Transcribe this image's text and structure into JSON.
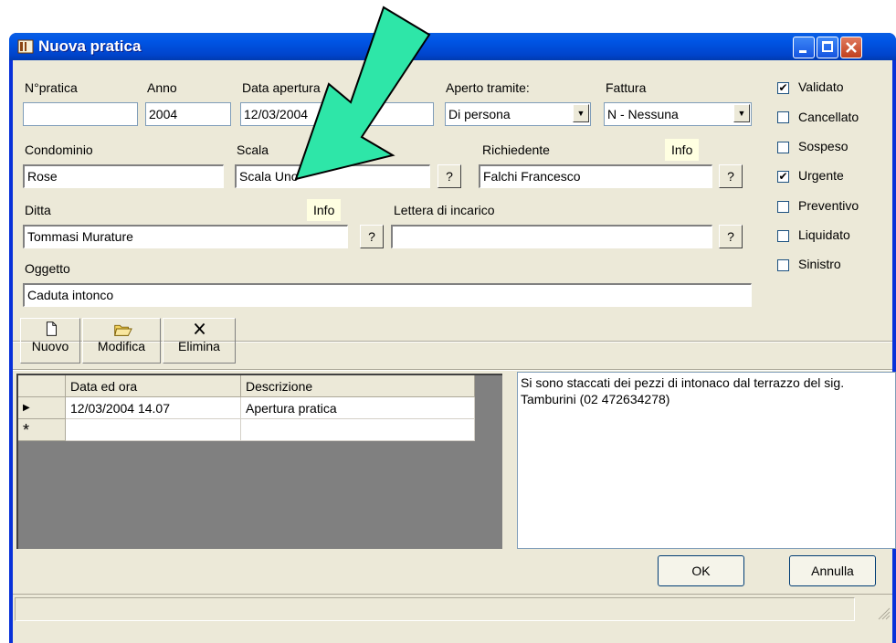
{
  "window": {
    "title": "Nuova pratica"
  },
  "form": {
    "npratica": {
      "label": "N°pratica",
      "value": ""
    },
    "anno": {
      "label": "Anno",
      "value": "2004"
    },
    "data_apertura": {
      "label": "Data apertura",
      "value": "12/03/2004"
    },
    "aperto_tramite": {
      "label": "Aperto tramite:",
      "value": "Di persona"
    },
    "fattura": {
      "label": "Fattura",
      "value": "N - Nessuna"
    },
    "condominio": {
      "label": "Condominio",
      "value": "Rose"
    },
    "scala": {
      "label": "Scala",
      "value": "Scala Uno"
    },
    "richiedente": {
      "label": "Richiedente",
      "value": "Falchi Francesco",
      "info": "Info"
    },
    "ditta": {
      "label": "Ditta",
      "value": "Tommasi Murature",
      "info": "Info"
    },
    "lettera": {
      "label": "Lettera di incarico",
      "value": ""
    },
    "oggetto": {
      "label": "Oggetto",
      "value": "Caduta intonco"
    },
    "lookup_label": "?"
  },
  "checkboxes": [
    {
      "label": "Validato",
      "checked": true
    },
    {
      "label": "Cancellato",
      "checked": false
    },
    {
      "label": "Sospeso",
      "checked": false
    },
    {
      "label": "Urgente",
      "checked": true
    },
    {
      "label": "Preventivo",
      "checked": false
    },
    {
      "label": "Liquidato",
      "checked": false
    },
    {
      "label": "Sinistro",
      "checked": false
    }
  ],
  "toolbar": {
    "nuovo": "Nuovo",
    "modifica": "Modifica",
    "elimina": "Elimina"
  },
  "grid": {
    "headers": [
      "Data ed ora",
      "Descrizione"
    ],
    "rows": [
      {
        "marker": "▶",
        "date": "12/03/2004 14.07",
        "desc": "Apertura pratica"
      }
    ],
    "new_marker": "*"
  },
  "memo": "Si sono staccati dei pezzi di intonaco dal terrazzo del sig. Tamburini (02 472634278)",
  "buttons": {
    "ok": "OK",
    "cancel": "Annulla"
  },
  "colors": {
    "arrow": "#2ee6a8",
    "title_bar": "#0055e5"
  }
}
